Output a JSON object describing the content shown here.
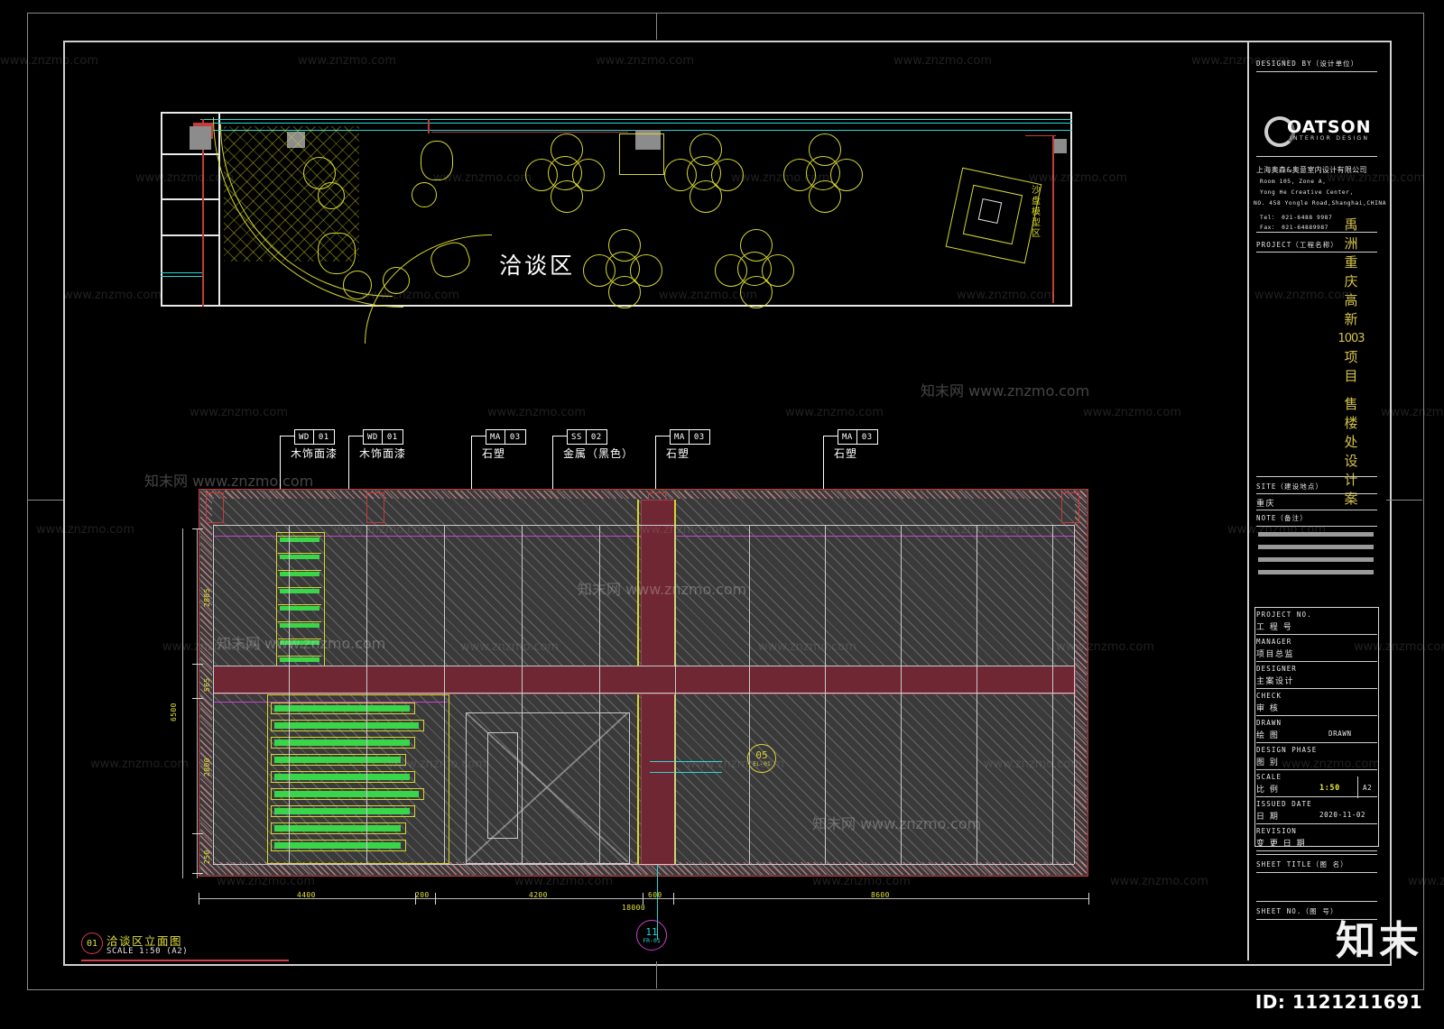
{
  "sheet": {
    "title_block": {
      "designed_by_label": "DESIGNED BY（设计单位）",
      "logo_name": "OATSON",
      "logo_sub": "INTERIOR DESIGN",
      "company_cn": "上海奥森&奥意室内设计有限公司",
      "address_lines": [
        "Room 105, Zone A,",
        "Yong He Creative Center,",
        "NO. 458 Yongle Road,Shanghai,CHINA",
        "Tel：  021-6488 9987",
        "Fax：  021-64889987"
      ],
      "project_label": "PROJECT（工程名称）",
      "project_name_vertical": [
        "禹",
        "洲",
        "重",
        "庆",
        "高",
        "新",
        "1003",
        "项",
        "目",
        "",
        "售",
        "楼",
        "处",
        "设",
        "计",
        "案"
      ],
      "site_label": "SITE（建设地点）",
      "site_value": "重庆",
      "note_label": "NOTE（备注）",
      "fields": [
        {
          "label": "PROJECT NO.",
          "cn": "工 程 号",
          "value": ""
        },
        {
          "label": "MANAGER",
          "cn": "项目总监",
          "value": ""
        },
        {
          "label": "DESIGNER",
          "cn": "主案设计",
          "value": ""
        },
        {
          "label": "CHECK",
          "cn": "审    核",
          "value": ""
        },
        {
          "label": "DRAWN",
          "cn": "绘    图",
          "value": "DRAWN"
        },
        {
          "label": "DESIGN PHASE",
          "cn": "图    别",
          "value": ""
        },
        {
          "label": "SCALE",
          "cn": "比    例",
          "value": "1:50",
          "value2": "A2"
        },
        {
          "label": "ISSUED DATE",
          "cn": "日    期",
          "value": "2020-11-02"
        },
        {
          "label": "REVISION",
          "cn": "变 更 日 期",
          "value": ""
        }
      ],
      "sheet_title_label": "SHEET TITLE（图  名）",
      "sheet_no_label": "SHEET NO.（图  号）"
    }
  },
  "plan": {
    "area_label": "洽谈区",
    "side_label": "沙盘模型区"
  },
  "elevation": {
    "callouts": [
      {
        "code": "WD",
        "num": "01",
        "cn": "木饰面漆"
      },
      {
        "code": "WD",
        "num": "01",
        "cn": "木饰面漆"
      },
      {
        "code": "MA",
        "num": "03",
        "cn": "石塑"
      },
      {
        "code": "SS",
        "num": "02",
        "cn": "金属（黑色）"
      },
      {
        "code": "MA",
        "num": "03",
        "cn": "石塑"
      },
      {
        "code": "MA",
        "num": "03",
        "cn": "石塑"
      }
    ],
    "dims_horizontal": [
      "4400",
      "200",
      "4200",
      "600",
      "8600"
    ],
    "dim_total_horizontal": "18000",
    "dims_vertical": [
      "2885",
      "565",
      "2800",
      "250"
    ],
    "dim_total_vertical": "6500",
    "bubbles": [
      {
        "number": "05",
        "sheet": "EL-01"
      },
      {
        "number": "11",
        "sheet": "FR-01"
      }
    ],
    "title": {
      "number": "01",
      "name": "洽谈区立面图",
      "scale": "SCALE  1:50 (A2)"
    }
  },
  "watermark": {
    "site_text": "znzmo.com",
    "brand": "知末",
    "id_text": "ID: 1121211691"
  },
  "colors": {
    "background": "#000000",
    "frame": "#cfcfcf",
    "yellow": "#d6d62e",
    "cyan": "#2ad7d7",
    "magenta": "#cf3fcf",
    "red": "#c43b3b",
    "maroon": "#7a1f2a",
    "green": "#3ad64a",
    "project_gold": "#d4c24a"
  }
}
